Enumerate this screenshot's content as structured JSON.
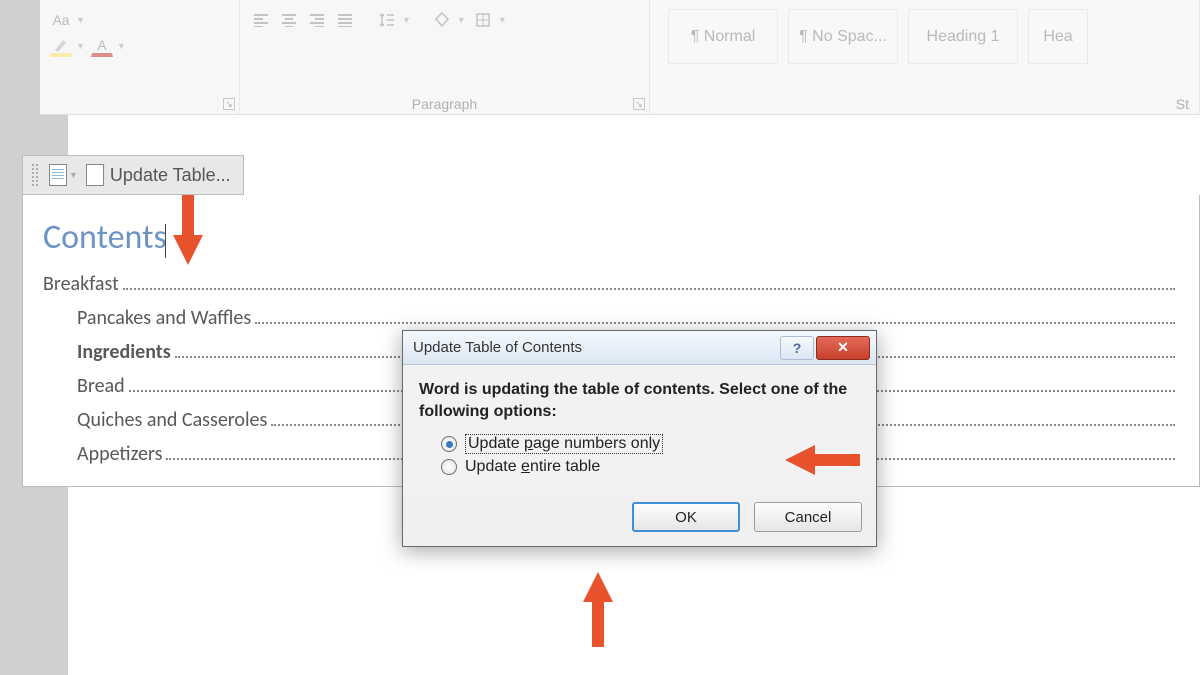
{
  "ribbon": {
    "groups": {
      "paragraph": {
        "label": "Paragraph"
      },
      "styles": {
        "label": "St"
      }
    },
    "styles": [
      "¶ Normal",
      "¶ No Spac...",
      "Heading 1",
      "Hea"
    ]
  },
  "toc": {
    "toolbar": {
      "update_label": "Update Table..."
    },
    "title": "Contents",
    "entries": [
      {
        "label": "Breakfast",
        "level": 1,
        "bold": false
      },
      {
        "label": "Pancakes and Waffles",
        "level": 2,
        "bold": false
      },
      {
        "label": "Ingredients",
        "level": 2,
        "bold": true
      },
      {
        "label": "Bread",
        "level": 2,
        "bold": false
      },
      {
        "label": "Quiches and Casseroles",
        "level": 2,
        "bold": false
      },
      {
        "label": "Appetizers",
        "level": 2,
        "bold": false
      }
    ]
  },
  "dialog": {
    "title": "Update Table of Contents",
    "instruction": "Word is updating the table of contents.  Select one of the following options:",
    "option1_prefix": "Update ",
    "option1_hotkey": "p",
    "option1_suffix": "age numbers only",
    "option2_prefix": "Update ",
    "option2_hotkey": "e",
    "option2_suffix": "ntire table",
    "ok": "OK",
    "cancel": "Cancel",
    "help_glyph": "?",
    "close_glyph": "✕"
  }
}
